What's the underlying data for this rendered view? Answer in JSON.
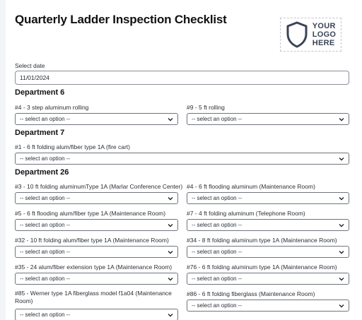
{
  "title": "Quarterly Ladder Inspection Checklist",
  "logo": {
    "text_line1": "YOUR",
    "text_line2": "LOGO",
    "text_line3": "HERE",
    "icon": "shield-icon"
  },
  "date": {
    "label": "Select date",
    "value": "11/01/2024"
  },
  "placeholder": "-- select an option --",
  "dept6": {
    "heading": "Department 6",
    "f1": "#4 - 3 step aluminum rolling",
    "f2": "#9 - 5 ft rolling"
  },
  "dept7": {
    "heading": "Department 7",
    "f1": "#1 - 6 ft folding alum/fiber type 1A (fire cart)"
  },
  "dept26": {
    "heading": "Department 26",
    "f1": "#3 - 10 ft folding aluminumType 1A (Marlar Conference Center)",
    "f2": "#4 - 6 ft flooding aluminum (Maintenance Room)",
    "f3": "#5 - 6 ft flooding alum/fiber type 1A (Maintenance Room)",
    "f4": "#7 - 4 ft folding aluminum (Telephone Room)",
    "f5": "#32 - 10 ft folding alum/fiber type 1A (Maintenance Room)",
    "f6": "#34 - 8 ft folding aluminum type 1A (Maintenance Room)",
    "f7": "#35 - 24 alum/fiber extension type 1A (Maintenance Room)",
    "f8": "#76 - 6 ft folding aluminum type 1A (Maintenance Room)",
    "f9": "#85 - Werner type 1A fiberglass model f1a04 (Maintenance Room)",
    "f10": "#86 - 6 ft folding fiberglass (Maintenance Room)"
  }
}
